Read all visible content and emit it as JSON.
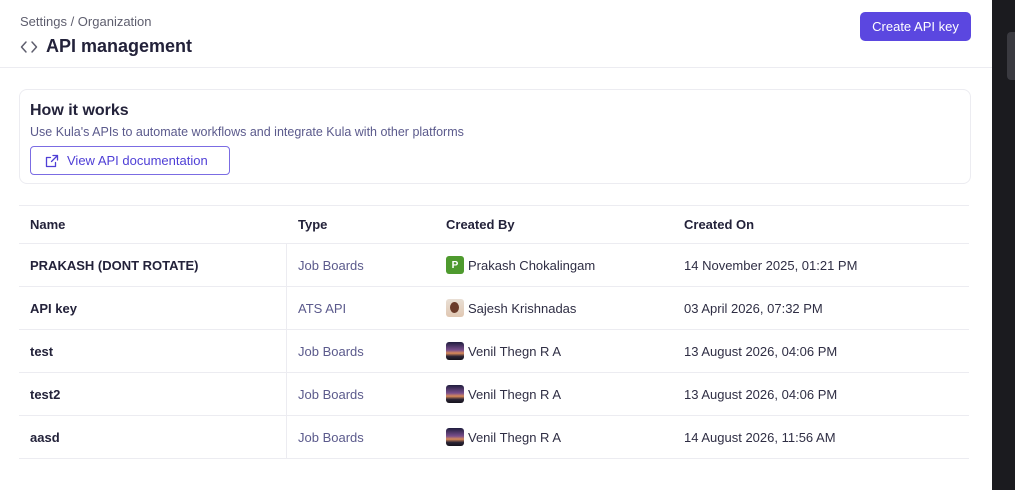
{
  "header": {
    "breadcrumb": "Settings / Organization",
    "title": "API management",
    "title_icon": "code-icon",
    "create_button": "Create API key",
    "accent": "#5b47e0"
  },
  "info": {
    "title": "How it works",
    "description": "Use Kula's APIs to automate workflows and integrate Kula with other platforms",
    "docs_button": "View API documentation",
    "docs_icon": "external-link-icon"
  },
  "table": {
    "columns": [
      "Name",
      "Type",
      "Created By",
      "Created On"
    ],
    "rows": [
      {
        "name": "PRAKASH (DONT ROTATE)",
        "type": "Job Boards",
        "created_by": "Prakash Chokalingam",
        "avatar_letter": "P",
        "created_on": "14 November 2025, 01:21 PM"
      },
      {
        "name": "API key",
        "type": "ATS API",
        "created_by": "Sajesh Krishnadas",
        "created_on": "03 April 2026, 07:32 PM"
      },
      {
        "name": "test",
        "type": "Job Boards",
        "created_by": "Venil Thegn R A",
        "created_on": "13 August 2026, 04:06 PM"
      },
      {
        "name": "test2",
        "type": "Job Boards",
        "created_by": "Venil Thegn R A",
        "created_on": "13 August 2026, 04:06 PM"
      },
      {
        "name": "aasd",
        "type": "Job Boards",
        "created_by": "Venil Thegn R A",
        "created_on": "14 August 2026, 11:56 AM"
      }
    ]
  }
}
